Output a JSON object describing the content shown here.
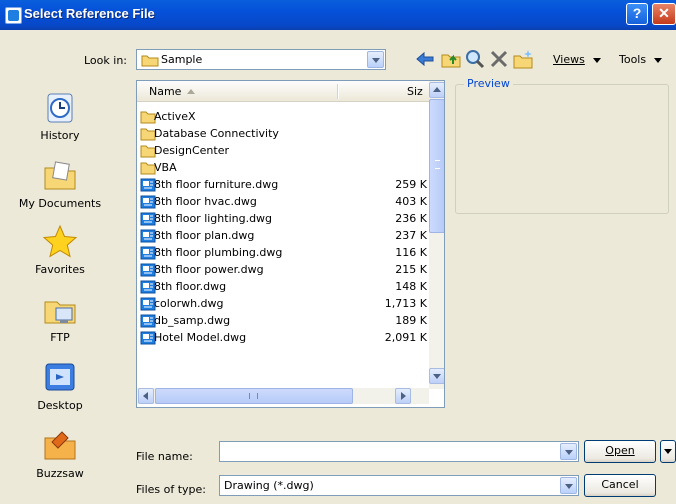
{
  "window": {
    "title": "Select Reference File"
  },
  "toolbar": {
    "look_in_label": "Look in:",
    "look_in_value": "Sample",
    "views_label": "Views",
    "tools_label": "Tools",
    "icons": [
      "back-arrow-icon",
      "up-folder-icon",
      "search-web-icon",
      "delete-icon",
      "new-folder-icon"
    ]
  },
  "places": [
    {
      "label": "History",
      "icon": "history-icon"
    },
    {
      "label": "My Documents",
      "icon": "my-documents-icon"
    },
    {
      "label": "Favorites",
      "icon": "favorites-star-icon"
    },
    {
      "label": "FTP",
      "icon": "ftp-icon"
    },
    {
      "label": "Desktop",
      "icon": "desktop-icon"
    },
    {
      "label": "Buzzsaw",
      "icon": "buzzsaw-icon"
    }
  ],
  "filelist": {
    "col_name": "Name",
    "col_size": "Siz",
    "rows": [
      {
        "name": "ActiveX",
        "size": "",
        "type": "folder"
      },
      {
        "name": "Database Connectivity",
        "size": "",
        "type": "folder"
      },
      {
        "name": "DesignCenter",
        "size": "",
        "type": "folder"
      },
      {
        "name": "VBA",
        "size": "",
        "type": "folder"
      },
      {
        "name": "8th floor furniture.dwg",
        "size": "259 K",
        "type": "dwg"
      },
      {
        "name": "8th floor hvac.dwg",
        "size": "403 K",
        "type": "dwg"
      },
      {
        "name": "8th floor lighting.dwg",
        "size": "236 K",
        "type": "dwg"
      },
      {
        "name": "8th floor plan.dwg",
        "size": "237 K",
        "type": "dwg"
      },
      {
        "name": "8th floor plumbing.dwg",
        "size": "116 K",
        "type": "dwg"
      },
      {
        "name": "8th floor power.dwg",
        "size": "215 K",
        "type": "dwg"
      },
      {
        "name": "8th floor.dwg",
        "size": "148 K",
        "type": "dwg"
      },
      {
        "name": "colorwh.dwg",
        "size": "1,713 K",
        "type": "dwg"
      },
      {
        "name": "db_samp.dwg",
        "size": "189 K",
        "type": "dwg"
      },
      {
        "name": "Hotel Model.dwg",
        "size": "2,091 K",
        "type": "dwg"
      }
    ]
  },
  "preview": {
    "label": "Preview"
  },
  "bottom": {
    "file_name_label": "File name:",
    "file_name_value": "",
    "files_of_type_label": "Files of type:",
    "files_of_type_value": "Drawing (*.dwg)",
    "open_label": "Open",
    "cancel_label": "Cancel"
  },
  "colors": {
    "title_bar": "#0550d8",
    "dialog_bg": "#ece9d8",
    "accent": "#1e7fe0"
  }
}
